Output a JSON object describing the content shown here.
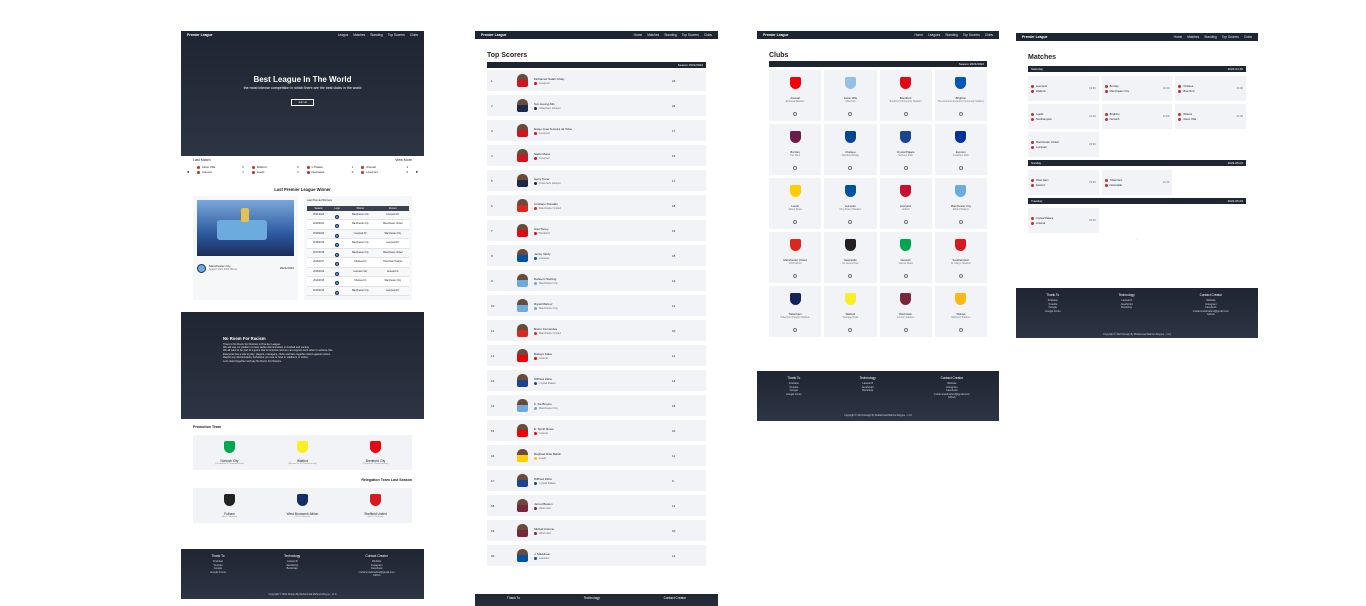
{
  "home": {
    "brand": "Premier League",
    "nav": [
      "Leagus",
      "Matches",
      "Standing",
      "Top Scorers",
      "Clubs"
    ],
    "hero_title": "Best League In The World",
    "hero_subtitle": "the most intense competition in which there are the best clubs in the world",
    "hero_button": "Join Us",
    "last_match": "Last Match",
    "view_more": "View More",
    "last_matches": [
      {
        "a": "Aston Villa",
        "as": "0",
        "b": "Arsenal",
        "bs": "1"
      },
      {
        "a": "Watford",
        "as": "0",
        "b": "Leeds",
        "bs": "3"
      },
      {
        "a": "C Palace",
        "as": "1",
        "b": "Newcastle",
        "bs": "0"
      },
      {
        "a": "Arsenal",
        "as": "3",
        "b": "Liverpool",
        "bs": "0"
      }
    ],
    "winner_title": "Last Premier League Winner",
    "winner_name": "Manchester City",
    "winner_sub": "Season 2021-2022 Winner",
    "winner_year": "2021/2022",
    "table_title": "Last Premier Winners",
    "table_headers": [
      "Season",
      "Logo",
      "Winner",
      "Runner"
    ],
    "table_rows": [
      [
        "2021/2022",
        "Manchester City",
        "Liverpool FC"
      ],
      [
        "2020/2021",
        "Manchester City",
        "Manchester United"
      ],
      [
        "2019/2020",
        "Liverpool FC",
        "Manchester City"
      ],
      [
        "2018/2019",
        "Manchester City",
        "Liverpool FC"
      ],
      [
        "2017/2018",
        "Manchester City",
        "Manchester United"
      ],
      [
        "2016/2017",
        "Chelsea FC",
        "Tottenham Hotspur"
      ],
      [
        "2015/2016",
        "Leicester City",
        "Arsenal FC"
      ],
      [
        "2014/2015",
        "Chelsea FC",
        "Manchester City"
      ],
      [
        "2013/2014",
        "Manchester City",
        "Liverpool FC"
      ]
    ],
    "racism_title": "No Room For Racism",
    "racism_lines": [
      "There is No Room For Racism in Premier League.",
      "We will use our platform to help tackle discrimination in football and society.",
      "We all want to be part of a game that is inclusive and we can support each other to achieve this.",
      "Everyone has a role to play: players, managers, clubs and fans together stand against racism.",
      "Report any discriminatory behaviour you see or hear in stadiums or online.",
      "Let's stand together and say No Room For Racism."
    ],
    "promotion_title": "Promotion Team",
    "promotion": [
      {
        "name": "Norwich City",
        "sub": "(Champion of Championship)"
      },
      {
        "name": "Watford",
        "sub": "(Runner up of Championship)"
      },
      {
        "name": "Brentford City",
        "sub": "(Play-off of Championship)"
      }
    ],
    "relegation_title": "Relegation Team Last Season",
    "relegation": [
      {
        "name": "Fulham",
        "sub": "(18 th / Season)"
      },
      {
        "name": "West Bromwich Albion",
        "sub": "(19 th / Season)"
      },
      {
        "name": "Sheffield United",
        "sub": "(20 th / Season)"
      }
    ],
    "footer": {
      "col1_title": "Thank To",
      "col1": [
        "Firebase",
        "Youtube",
        "Google",
        "Google Fonts"
      ],
      "col2_title": "Technology",
      "col2": [
        "Laravel 8",
        "JavaScript",
        "Bootstrap"
      ],
      "col3_title": "Contact Creator",
      "col3": [
        "Website",
        "Instagram",
        "Facebook",
        "muhammadmahruf@gmail.com",
        "Github"
      ],
      "copyright": "Copyright © 2021 Design By Muhammad Mahrus Abiyyus - v1.0"
    }
  },
  "scorers": {
    "brand": "Premier League",
    "nav": [
      "Home",
      "Matches",
      "Standing",
      "Top Scorers",
      "Clubs"
    ],
    "title": "Top Scorers",
    "season": "Season 2021/2022",
    "rows": [
      {
        "rank": "1",
        "name": "Mohamed Salah Ghaly",
        "club": "Liverpool",
        "goals": "23",
        "c": "#d3131f"
      },
      {
        "rank": "2",
        "name": "Son Heung-Min",
        "club": "Tottenham Hotspur",
        "goals": "23",
        "c": "#1b2a4a"
      },
      {
        "rank": "3",
        "name": "Diogo José Teixeira da Silva",
        "club": "Liverpool",
        "goals": "17",
        "c": "#d3131f"
      },
      {
        "rank": "4",
        "name": "Sadio Mané",
        "club": "Liverpool",
        "goals": "16",
        "c": "#d3131f"
      },
      {
        "rank": "5",
        "name": "Harry Kane",
        "club": "Tottenham Hotspur",
        "goals": "17",
        "c": "#1b2a4a"
      },
      {
        "rank": "6",
        "name": "Cristiano Ronaldo",
        "club": "Manchester United",
        "goals": "18",
        "c": "#da291c"
      },
      {
        "rank": "7",
        "name": "Ivan Toney",
        "club": "Brentford",
        "goals": "12",
        "c": "#e30613"
      },
      {
        "rank": "8",
        "name": "Jamie Vardy",
        "club": "Leicester",
        "goals": "15",
        "c": "#0053a0"
      },
      {
        "rank": "9",
        "name": "Raheem Sterling",
        "club": "Manchester City",
        "goals": "13",
        "c": "#6cabdd"
      },
      {
        "rank": "10",
        "name": "Riyad Mahrez",
        "club": "Manchester City",
        "goals": "11",
        "c": "#6cabdd"
      },
      {
        "rank": "11",
        "name": "Bruno Fernandes",
        "club": "Manchester United",
        "goals": "10",
        "c": "#da291c"
      },
      {
        "rank": "12",
        "name": "Bukayo Saka",
        "club": "Arsenal",
        "goals": "11",
        "c": "#ef0107"
      },
      {
        "rank": "13",
        "name": "Wilfried Zaha",
        "club": "Crystal Palace",
        "goals": "14",
        "c": "#1b458f"
      },
      {
        "rank": "14",
        "name": "K. De Bruyne",
        "club": "Manchester City",
        "goals": "15",
        "c": "#6cabdd"
      },
      {
        "rank": "15",
        "name": "E. Smith Rowe",
        "club": "Arsenal",
        "goals": "10",
        "c": "#ef0107"
      },
      {
        "rank": "16",
        "name": "Raphael Dias Belloli",
        "club": "Leeds",
        "goals": "11",
        "c": "#ffcd00"
      },
      {
        "rank": "17",
        "name": "Wilfried Zaha",
        "club": "Crystal Palace",
        "goals": "9",
        "c": "#1b458f"
      },
      {
        "rank": "18",
        "name": "Jarrod Bowen",
        "club": "West Ham",
        "goals": "12",
        "c": "#7a263a"
      },
      {
        "rank": "19",
        "name": "Michail Antonio",
        "club": "West Ham",
        "goals": "10",
        "c": "#7a263a"
      },
      {
        "rank": "20",
        "name": "J. Maddison",
        "club": "Leicester",
        "goals": "12",
        "c": "#0053a0"
      }
    ],
    "footer": {
      "col1_title": "Thank To",
      "col2_title": "Technology",
      "col3_title": "Contact Creator"
    }
  },
  "clubs": {
    "brand": "Premier League",
    "nav": [
      "Home",
      "Leagues",
      "Standing",
      "Top Scorers",
      "Clubs"
    ],
    "title": "Clubs",
    "season": "Season 2021/2022",
    "list": [
      {
        "name": "Arsenal",
        "ground": "Emirates Stadium",
        "c": "#ef0107"
      },
      {
        "name": "Aston Villa",
        "ground": "Villa Park",
        "c": "#95bfe5"
      },
      {
        "name": "Brentford",
        "ground": "Brentford Community Stadium",
        "c": "#e30613"
      },
      {
        "name": "Brighton",
        "ground": "The American Express Community Stadium",
        "c": "#0057b8"
      },
      {
        "name": "Burnley",
        "ground": "Turf Moor",
        "c": "#6c1d45"
      },
      {
        "name": "Chelsea",
        "ground": "Stamford Bridge",
        "c": "#034694"
      },
      {
        "name": "Crystal Palace",
        "ground": "Selhurst Park",
        "c": "#1b458f"
      },
      {
        "name": "Everton",
        "ground": "Goodison Park",
        "c": "#003399"
      },
      {
        "name": "Leeds",
        "ground": "Elland Road",
        "c": "#ffcd00"
      },
      {
        "name": "Leicester",
        "ground": "King Power Stadium",
        "c": "#0053a0"
      },
      {
        "name": "Liverpool",
        "ground": "Anfield",
        "c": "#c8102e"
      },
      {
        "name": "Manchester City",
        "ground": "Etihad Stadium",
        "c": "#6cabdd"
      },
      {
        "name": "Manchester United",
        "ground": "Old Trafford",
        "c": "#da291c"
      },
      {
        "name": "Newcastle",
        "ground": "St. James Park",
        "c": "#241f20"
      },
      {
        "name": "Norwich",
        "ground": "Carrow Road",
        "c": "#00a650"
      },
      {
        "name": "Southampton",
        "ground": "St. Mary's Stadium",
        "c": "#d71920"
      },
      {
        "name": "Tottenham",
        "ground": "Tottenham Hotspur Stadium",
        "c": "#132257"
      },
      {
        "name": "Watford",
        "ground": "Vicarage Road",
        "c": "#fbee23"
      },
      {
        "name": "West Ham",
        "ground": "London Stadium",
        "c": "#7a263a"
      },
      {
        "name": "Wolves",
        "ground": "Molineux Stadium",
        "c": "#fdb913"
      }
    ],
    "footer": {
      "col1_title": "Thank To",
      "col1": [
        "Firebase",
        "Youtube",
        "Google",
        "Google Fonts"
      ],
      "col2_title": "Technology",
      "col2": [
        "Laravel 8",
        "JavaScript",
        "Bootstrap"
      ],
      "col3_title": "Contact Creator",
      "col3": [
        "Website",
        "Instagram",
        "Facebook",
        "muhammadmahruf@gmail.com",
        "Github"
      ],
      "copyright": "Copyright © 2021 Design By Muhammad Mahrus Abiyyus - v1.0"
    }
  },
  "matches": {
    "brand": "Premier League",
    "nav": [
      "Home",
      "Matches",
      "Standing",
      "Top Scorers",
      "Clubs"
    ],
    "title": "Matches",
    "days": [
      {
        "day": "Saturday",
        "date": "2022-04-30",
        "games": [
          {
            "a": "Liverpool",
            "b": "Watford",
            "t": "19:30"
          },
          {
            "a": "Burnley",
            "b": "Manchester City",
            "t": "21:00"
          },
          {
            "a": "Chelsea",
            "b": "Brentford",
            "t": "21:00"
          },
          {
            "a": "Leeds",
            "b": "Southampton",
            "t": "21:00"
          },
          {
            "a": "Brighton",
            "b": "Norwich",
            "t": "21:00"
          },
          {
            "a": "Wolves",
            "b": "Aston Villa",
            "t": "21:00"
          },
          {
            "a": "Manchester United",
            "b": "Leicester",
            "t": "23:30"
          }
        ]
      },
      {
        "day": "Sunday",
        "date": "2022-05-01",
        "games": [
          {
            "a": "West Ham",
            "b": "Everton",
            "t": "19:00"
          },
          {
            "a": "Tottenham",
            "b": "Newcastle",
            "t": "21:30"
          }
        ]
      },
      {
        "day": "Tuesday",
        "date": "2022-05-03",
        "games": [
          {
            "a": "Crystal Palace",
            "b": "Arsenal",
            "t": "02:00"
          }
        ]
      }
    ],
    "footer": {
      "col1_title": "Thank To",
      "col1": [
        "Firebase",
        "Youtube",
        "Google",
        "Google Fonts"
      ],
      "col2_title": "Technology",
      "col2": [
        "Laravel 8",
        "JavaScript",
        "Bootstrap"
      ],
      "col3_title": "Contact Creator",
      "col3": [
        "Website",
        "Instagram",
        "Facebook",
        "muhammadmahruf@gmail.com",
        "Github"
      ],
      "copyright": "Copyright © 2021 Design By Muhammad Mahrus Abiyyus - v1.0"
    }
  }
}
